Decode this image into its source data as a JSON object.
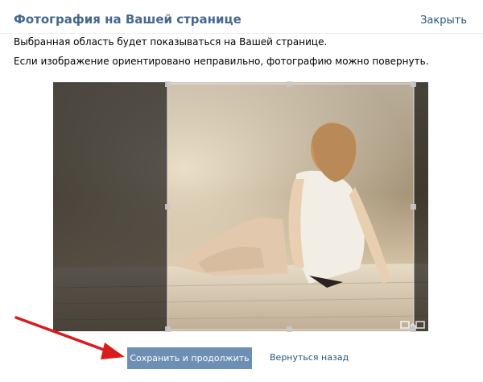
{
  "dialog": {
    "title": "Фотография на Вашей странице",
    "close_label": "Закрыть"
  },
  "description": {
    "line1": "Выбранная область будет показываться на Вашей странице.",
    "line2": "Если изображение ориентировано неправильно, фотографию можно повернуть."
  },
  "actions": {
    "save_label": "Сохранить и продолжить",
    "back_label": "Вернуться назад"
  },
  "icons": {
    "rotate": "rotate-icon",
    "arrow": "red-arrow-annotation"
  },
  "colors": {
    "title": "#45688e",
    "link": "#2b587a",
    "button": "#6d8fb3",
    "arrow": "#d91c1c"
  }
}
